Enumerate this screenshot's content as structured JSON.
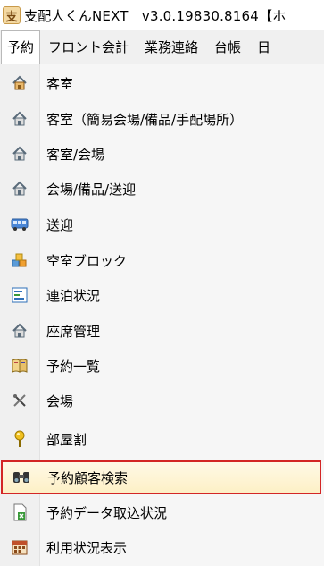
{
  "window": {
    "app_icon_glyph": "支",
    "title": "支配人くんNEXT　v3.0.19830.8164【ホ"
  },
  "menubar": {
    "items": [
      "予約",
      "フロント会計",
      "業務連絡",
      "台帳",
      "日"
    ],
    "active_index": 0
  },
  "dropdown": {
    "items": [
      {
        "label": "客室",
        "icon": "house-icon"
      },
      {
        "label": "客室（簡易会場/備品/手配場所）",
        "icon": "house-icon"
      },
      {
        "label": "客室/会場",
        "icon": "house-icon"
      },
      {
        "label": "会場/備品/送迎",
        "icon": "house-icon"
      },
      {
        "label": "送迎",
        "icon": "bus-icon"
      },
      {
        "label": "空室ブロック",
        "icon": "blocks-icon"
      },
      {
        "label": "連泊状況",
        "icon": "chart-icon"
      },
      {
        "label": "座席管理",
        "icon": "house-icon"
      },
      {
        "label": "予約一覧",
        "icon": "book-icon"
      },
      {
        "label": "会場",
        "icon": "utensils-icon"
      },
      {
        "label": "部屋割",
        "icon": "pin-icon"
      },
      {
        "label": "予約顧客検索",
        "icon": "binoculars-icon"
      },
      {
        "label": "予約データ取込状況",
        "icon": "import-icon"
      },
      {
        "label": "利用状況表示",
        "icon": "calendar-icon"
      }
    ],
    "highlighted_index": 11
  },
  "colors": {
    "highlight_border": "#d32626",
    "highlight_fill": "#fdf0c6",
    "menubar_bg": "#f0f0f0"
  }
}
